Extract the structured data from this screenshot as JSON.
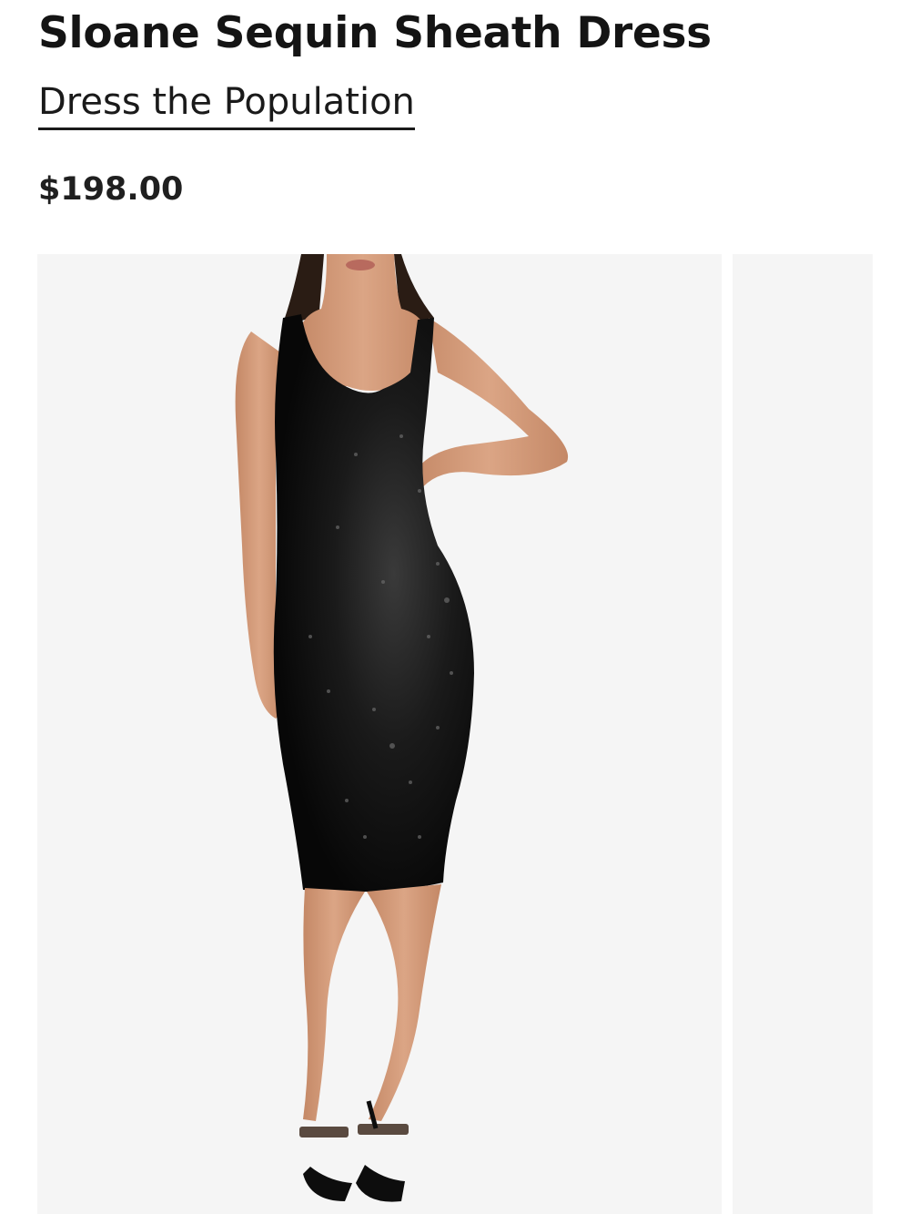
{
  "product": {
    "title": "Sloane Sequin Sheath Dress",
    "brand": "Dress the Population",
    "price": "$198.00"
  },
  "gallery": {
    "current_image": 1
  },
  "colors": {
    "text": "#141414",
    "image_background": "#f5f5f5",
    "dress": "#0e0e0e",
    "skin": "#d39a78"
  }
}
